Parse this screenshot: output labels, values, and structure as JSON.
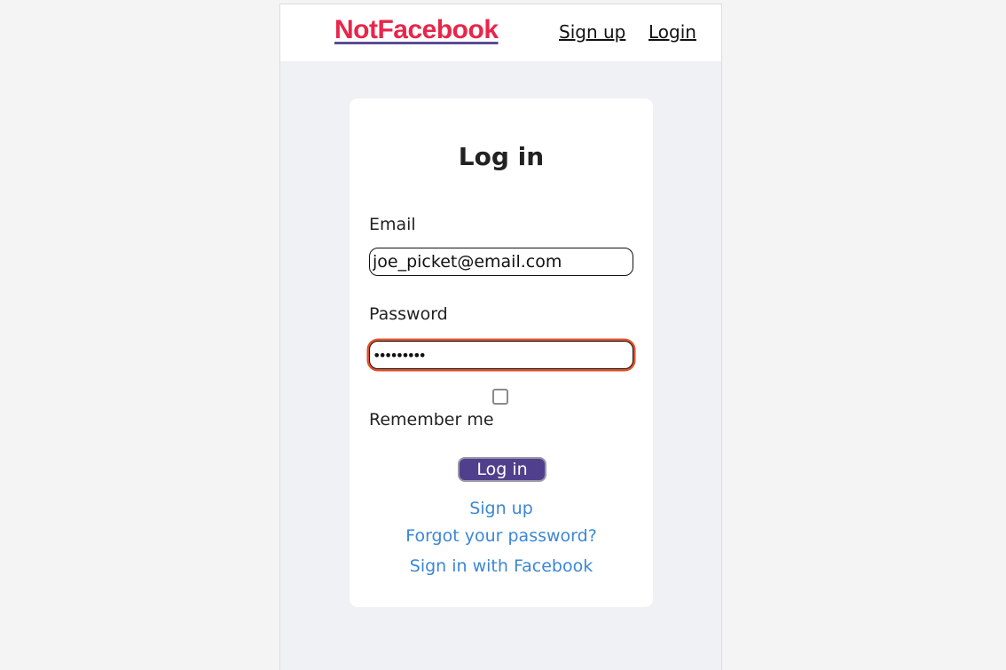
{
  "header": {
    "logo_text": "NotFacebook",
    "nav": {
      "signup_label": "Sign up",
      "login_label": "Login"
    }
  },
  "login_form": {
    "title": "Log in",
    "email": {
      "label": "Email",
      "value": "joe_picket@email.com"
    },
    "password": {
      "label": "Password",
      "masked_value": "•••••••••"
    },
    "remember_me": {
      "label": "Remember me",
      "checked": false
    },
    "submit_label": "Log in",
    "links": {
      "signup": "Sign up",
      "forgot_password": "Forgot your password?",
      "facebook": "Sign in with Facebook"
    }
  },
  "colors": {
    "logo_text": "#e8264a",
    "logo_underline": "#5b4c93",
    "button_bg": "#4f3f8c",
    "link": "#3b87d6",
    "focus_ring": "#e4502a",
    "page_bg": "#f0f1f4"
  }
}
